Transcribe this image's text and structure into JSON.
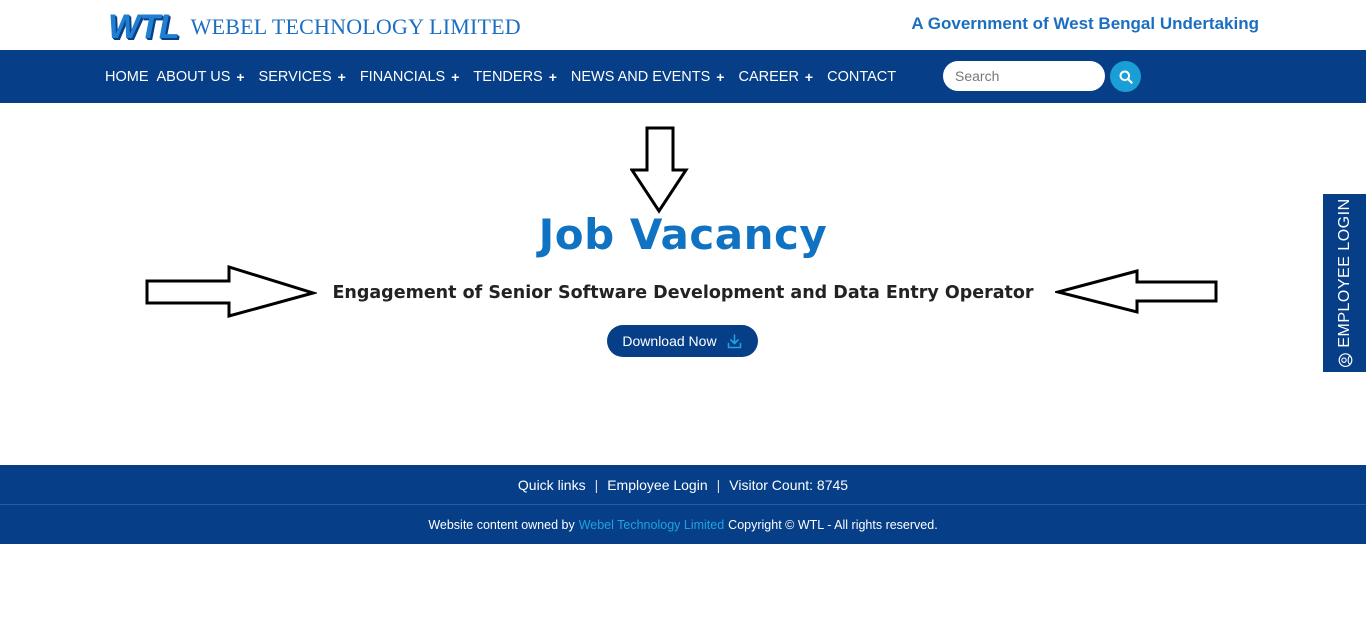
{
  "header": {
    "logo_mark": "WTL",
    "logo_text": "WEBEL TECHNOLOGY LIMITED",
    "tagline": "A Government of West Bengal Undertaking"
  },
  "nav": {
    "items": [
      {
        "label": "HOME",
        "has_submenu": false
      },
      {
        "label": "ABOUT US",
        "has_submenu": true
      },
      {
        "label": "SERVICES",
        "has_submenu": true
      },
      {
        "label": "FINANCIALS",
        "has_submenu": true
      },
      {
        "label": "TENDERS",
        "has_submenu": true
      },
      {
        "label": "NEWS AND EVENTS",
        "has_submenu": true
      },
      {
        "label": "CAREER",
        "has_submenu": true
      },
      {
        "label": "CONTACT",
        "has_submenu": false
      }
    ],
    "plus": "+",
    "search_placeholder": "Search",
    "search_value": "",
    "search_icon": "search-icon"
  },
  "main": {
    "title": "Job Vacancy",
    "subtitle": "Engagement of Senior Software Development and Data Entry Operator",
    "download_label": "Download Now",
    "download_icon": "download-icon"
  },
  "side_tab": {
    "label": "EMPLOYEE LOGIN",
    "icon": "user-circle-icon"
  },
  "footer": {
    "links": [
      "Quick links",
      "Employee Login",
      "Visitor Count: 8745"
    ],
    "separator": "|",
    "copy_prefix": "Website content owned by",
    "owner": "Webel Technology Limited",
    "copy_suffix": "Copyright © WTL - All rights reserved."
  },
  "colors": {
    "navy": "#063e87",
    "accent_blue": "#0f72c2",
    "search_button": "#1a9ed6",
    "link_cyan": "#1ea3e0"
  }
}
